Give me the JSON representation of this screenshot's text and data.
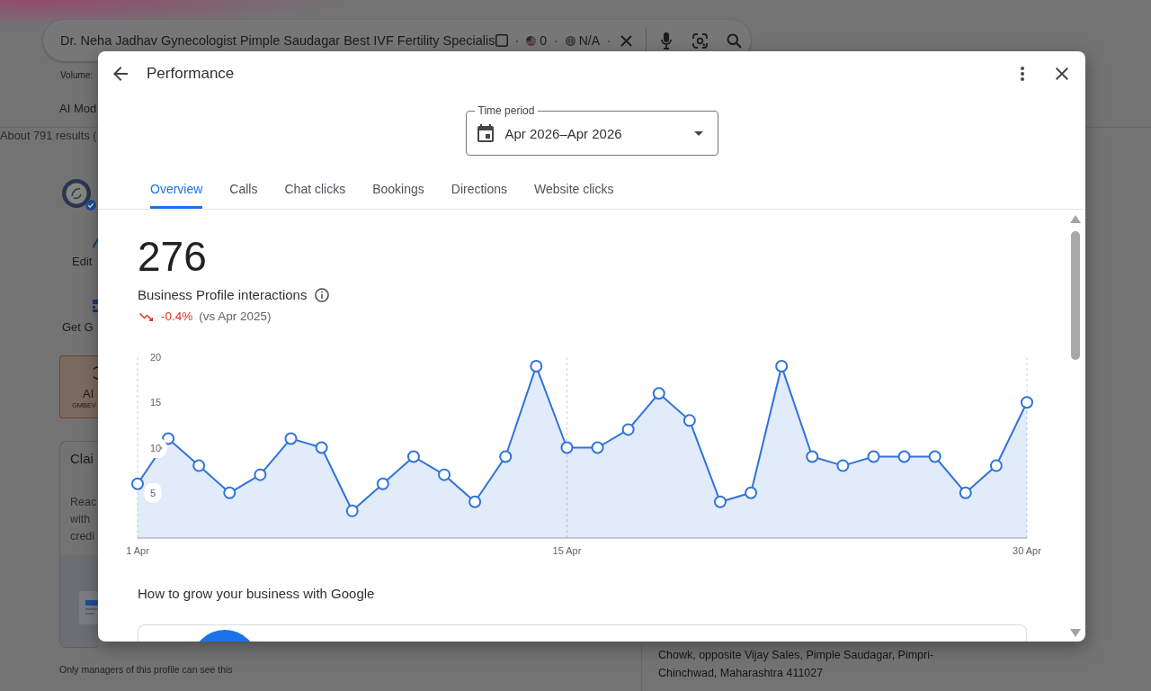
{
  "background_page": {
    "search_bar": {
      "query": "Dr. Neha Jadhav Gynecologist Pimple Saudagar Best IVF Fertility Specialis",
      "extension_items": [
        {
          "kind": "checkbox",
          "checked": false
        },
        {
          "kind": "separator",
          "text": "·"
        },
        {
          "kind": "flag",
          "text": "0"
        },
        {
          "kind": "separator",
          "text": "·"
        },
        {
          "kind": "coin",
          "text": "N/A"
        },
        {
          "kind": "separator",
          "text": "·"
        }
      ]
    },
    "volume_label": "Volume:",
    "tab_fragment": "AI Mod",
    "results_count": "About 791 results (",
    "profile_actions": [
      {
        "kind": "pencil",
        "label": "Edit"
      },
      {
        "kind": "grid",
        "label": "Get G"
      }
    ],
    "ai_card": {
      "title": "AI",
      "subtitle": "GMBEV"
    },
    "claim_card": {
      "title": "Clai",
      "body_lines": [
        "Reac",
        "with",
        "credi"
      ]
    },
    "managers_note": "Only managers of this profile can see this",
    "address_lines": [
      "Chowk, opposite Vijay Sales, Pimple Saudagar, Pimpri-",
      "Chinchwad, Maharashtra 411027"
    ]
  },
  "dialog": {
    "title": "Performance",
    "time_period": {
      "label": "Time period",
      "value": "Apr 2026–Apr 2026"
    },
    "tabs": [
      {
        "label": "Overview",
        "selected": true
      },
      {
        "label": "Calls",
        "selected": false
      },
      {
        "label": "Chat clicks",
        "selected": false
      },
      {
        "label": "Bookings",
        "selected": false
      },
      {
        "label": "Directions",
        "selected": false
      },
      {
        "label": "Website clicks",
        "selected": false
      }
    ],
    "metric": {
      "value": "276",
      "label": "Business Profile interactions",
      "negative": true,
      "change": "-0.4%",
      "comparison": "(vs Apr 2025)"
    },
    "chart_data": {
      "type": "area",
      "categories": [
        "1 Apr",
        null,
        null,
        null,
        null,
        null,
        null,
        null,
        null,
        null,
        null,
        null,
        null,
        null,
        "15 Apr",
        null,
        null,
        null,
        null,
        null,
        null,
        null,
        null,
        null,
        null,
        null,
        null,
        null,
        null,
        "30 Apr"
      ],
      "series": [
        {
          "color": "#2f73d9",
          "values": [
            6,
            11,
            8,
            5,
            7,
            11,
            10,
            3,
            6,
            9,
            7,
            4,
            9,
            19,
            10,
            10,
            12,
            16,
            13,
            4,
            5,
            19,
            9,
            8,
            9,
            9,
            9,
            5,
            8,
            15
          ]
        }
      ],
      "ylim": [
        0,
        20
      ],
      "yticks": [
        5,
        10,
        15,
        20
      ]
    },
    "section_title": "How to grow your business with Google"
  }
}
